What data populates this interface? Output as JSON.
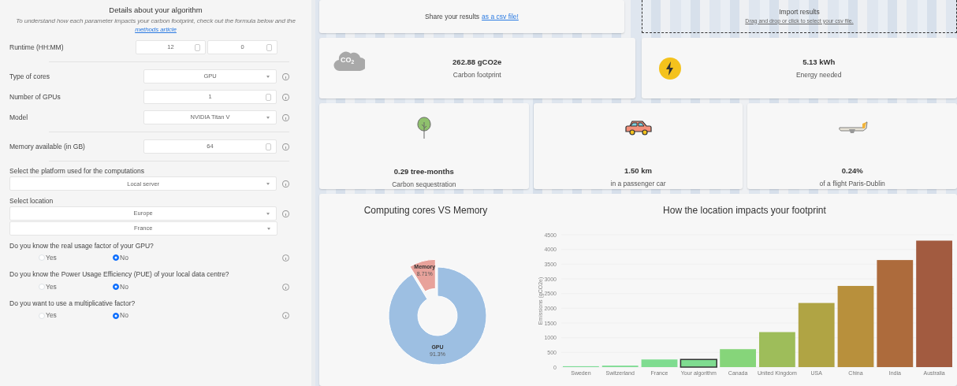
{
  "sidebar": {
    "title": "Details about your algorithm",
    "intro": "To understand how each parameter impacts your carbon footprint, check out the formula below and the",
    "intro_link": "methods article",
    "fields": [
      {
        "kind": "time",
        "label": "Runtime (HH:MM)",
        "values": [
          "12",
          "0"
        ],
        "info": false
      },
      {
        "kind": "divider"
      },
      {
        "kind": "select",
        "label": "Type of cores",
        "value": "GPU",
        "info": true
      },
      {
        "kind": "number",
        "label": "Number of GPUs",
        "value": "1",
        "info": true
      },
      {
        "kind": "select",
        "label": "Model",
        "value": "NVIDIA Titan V",
        "info": true
      },
      {
        "kind": "divider"
      },
      {
        "kind": "number",
        "label": "Memory available (in GB)",
        "value": "64",
        "info": true
      },
      {
        "kind": "divider"
      },
      {
        "kind": "heading",
        "label": "Select the platform used for the computations"
      },
      {
        "kind": "wide-select",
        "value": "Local server",
        "info": true
      },
      {
        "kind": "heading",
        "label": "Select location"
      },
      {
        "kind": "wide-select",
        "value": "Europe",
        "info": true
      },
      {
        "kind": "wide-select",
        "value": "France",
        "info": false
      },
      {
        "kind": "radio",
        "label": "Do you know the real usage factor of your GPU?",
        "options": [
          {
            "label": "Yes",
            "selected": false
          },
          {
            "label": "No",
            "selected": true
          }
        ],
        "info": true
      },
      {
        "kind": "radio",
        "label": "Do you know the Power Usage Efficiency (PUE) of your local data centre?",
        "options": [
          {
            "label": "Yes",
            "selected": false
          },
          {
            "label": "No",
            "selected": true
          }
        ],
        "info": true
      },
      {
        "kind": "radio",
        "label": "Do you want to use a multiplicative factor?",
        "options": [
          {
            "label": "Yes",
            "selected": false
          },
          {
            "label": "No",
            "selected": true
          }
        ],
        "info": true
      }
    ]
  },
  "share": {
    "text": "Share your results",
    "link": "as a csv file!"
  },
  "import": {
    "title": "Import results",
    "hint": "Drag and drop or click to select your csv file."
  },
  "metrics_top": [
    {
      "kind": "co2",
      "icon_label": "CO$_{2}$",
      "value": "262.88 gCO2e",
      "caption": "Carbon footprint"
    },
    {
      "kind": "energy",
      "value": "5.13 kWh",
      "caption": "Energy needed"
    }
  ],
  "metrics_bottom": [
    {
      "kind": "tree",
      "value": "0.29 tree-months",
      "caption": "Carbon sequestration"
    },
    {
      "kind": "car",
      "value": "1.50 km",
      "caption": "in a passenger car"
    },
    {
      "kind": "plane",
      "value": "0.24%",
      "caption": "of a flight Paris-Dublin"
    }
  ],
  "donut": {
    "chart_data": {
      "type": "donut",
      "title": "Computing cores VS Memory",
      "categories": [
        "GPU",
        "Memory"
      ],
      "values": [
        91.3,
        8.71
      ],
      "colors": [
        "#9dbfe2",
        "#e8a29b"
      ],
      "value_labels": [
        "91.3%",
        "8.71%"
      ]
    }
  },
  "location_chart": {
    "highlighted": [
      false,
      false,
      false,
      true,
      false,
      false,
      false,
      false,
      false,
      false
    ],
    "chart_data": {
      "type": "bar",
      "title": "How the location impacts your footprint",
      "ylabel": "Emissions (gCO2e)",
      "categories": [
        "Sweden",
        "Switzerland",
        "France",
        "Your algorithm",
        "Canada",
        "United Kingdom",
        "USA",
        "China",
        "India",
        "Australia"
      ],
      "values": [
        30,
        50,
        260,
        260,
        610,
        1190,
        2180,
        2760,
        3640,
        4300
      ],
      "grid": true,
      "colors": [
        "#7fdc97",
        "#80dc95",
        "#7fdc90",
        "#7fdc90",
        "#86d57a",
        "#9ebd5a",
        "#b0a444",
        "#b8903c",
        "#ad6b3c",
        "#a25b40"
      ],
      "ylim": [
        0,
        4500
      ],
      "yticks": [
        0,
        500,
        1000,
        1500,
        2000,
        2500,
        3000,
        3500,
        4000,
        4500
      ]
    }
  }
}
